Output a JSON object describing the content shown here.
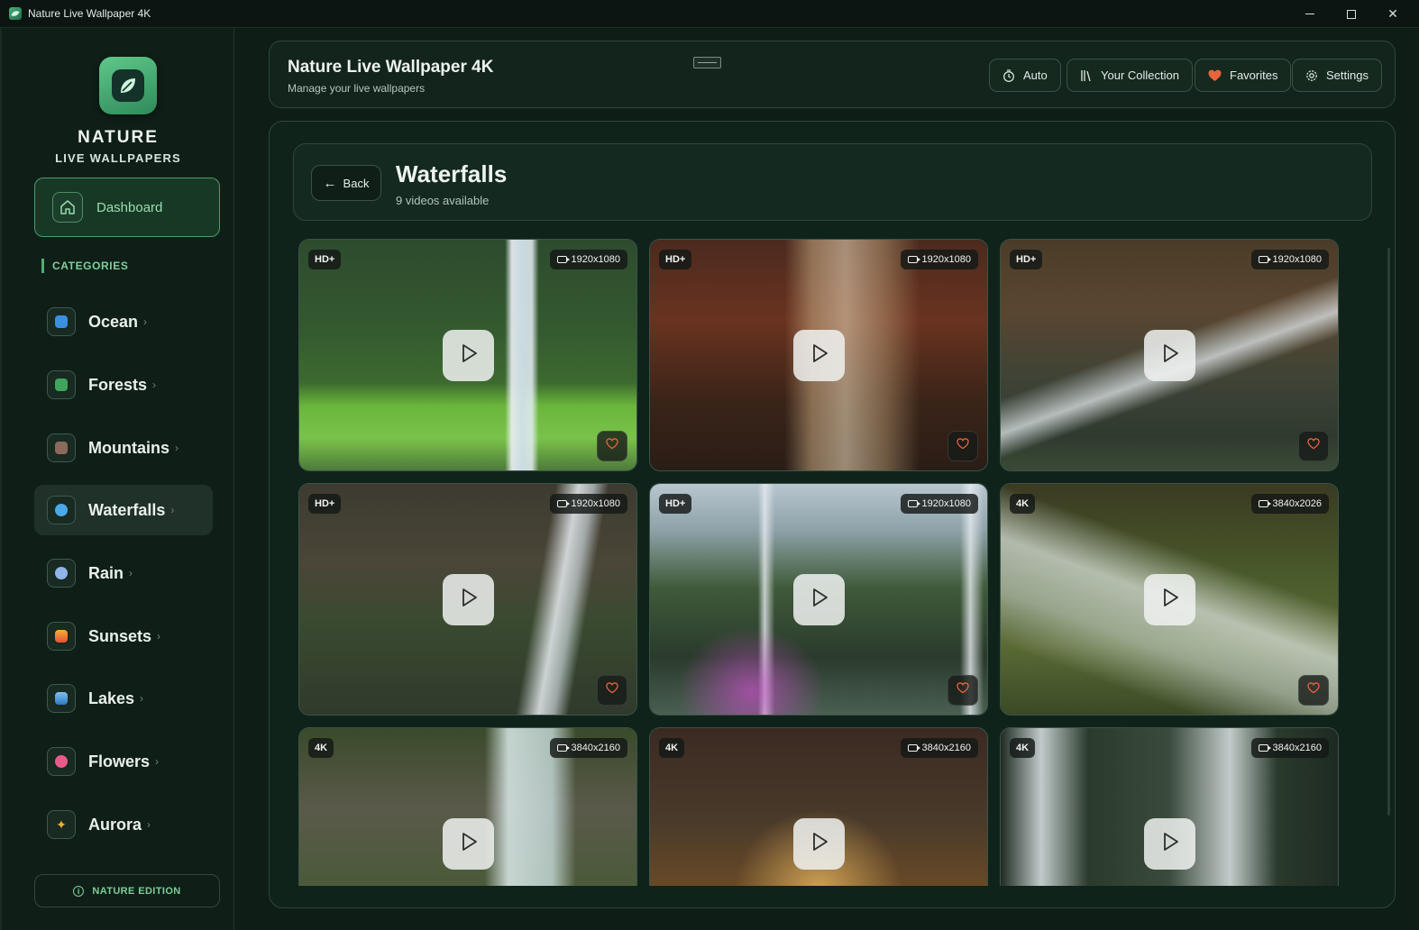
{
  "window": {
    "title": "Nature Live Wallpaper 4K"
  },
  "sidebar": {
    "brand_line1": "NATURE",
    "brand_line2": "LIVE WALLPAPERS",
    "dashboard_label": "Dashboard",
    "categories_heading": "CATEGORIES",
    "items": [
      {
        "label": "Ocean",
        "icon": "wave-icon",
        "color": "#3b8fe0"
      },
      {
        "label": "Forests",
        "icon": "tree-icon",
        "color": "#3fa55c"
      },
      {
        "label": "Mountains",
        "icon": "mountain-icon",
        "color": "#8a6a5a"
      },
      {
        "label": "Waterfalls",
        "icon": "droplet-icon",
        "color": "#4aa8e8"
      },
      {
        "label": "Rain",
        "icon": "rain-cloud-icon",
        "color": "#8fb4e8"
      },
      {
        "label": "Sunsets",
        "icon": "sunset-icon",
        "color": "#f07a3a"
      },
      {
        "label": "Lakes",
        "icon": "lake-icon",
        "color": "#4a9ad8"
      },
      {
        "label": "Flowers",
        "icon": "flower-icon",
        "color": "#e85a8a"
      },
      {
        "label": "Aurora",
        "icon": "sparkle-icon",
        "color": "#f0b03a"
      }
    ],
    "active_item": "Waterfalls",
    "edition_label": "NATURE EDITION"
  },
  "header": {
    "title": "Nature Live Wallpaper 4K",
    "subtitle": "Manage your live wallpapers",
    "buttons": {
      "auto": "Auto",
      "collection": "Your Collection",
      "favorites": "Favorites",
      "settings": "Settings"
    }
  },
  "page": {
    "back_label": "Back",
    "title": "Waterfalls",
    "subtitle": "9 videos available"
  },
  "videos": [
    {
      "badge": "HD+",
      "resolution": "1920x1080"
    },
    {
      "badge": "HD+",
      "resolution": "1920x1080"
    },
    {
      "badge": "HD+",
      "resolution": "1920x1080"
    },
    {
      "badge": "HD+",
      "resolution": "1920x1080"
    },
    {
      "badge": "HD+",
      "resolution": "1920x1080"
    },
    {
      "badge": "4K",
      "resolution": "3840x2026"
    },
    {
      "badge": "4K",
      "resolution": "3840x2160"
    },
    {
      "badge": "4K",
      "resolution": "3840x2160"
    },
    {
      "badge": "4K",
      "resolution": "3840x2160"
    }
  ],
  "colors": {
    "accent": "#4caf6c",
    "background": "#0f1d17",
    "favorite": "#e8643c"
  }
}
